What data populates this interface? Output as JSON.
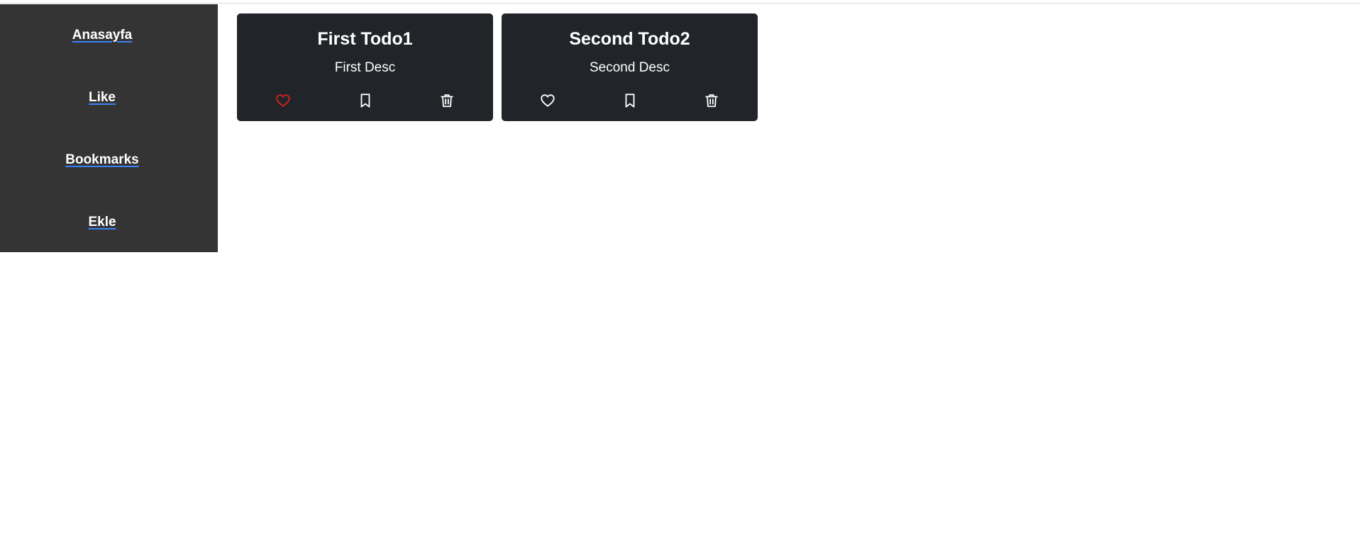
{
  "sidebar": {
    "items": [
      {
        "label": "Anasayfa"
      },
      {
        "label": "Like"
      },
      {
        "label": "Bookmarks"
      },
      {
        "label": "Ekle"
      }
    ]
  },
  "todos": [
    {
      "title": "First Todo1",
      "description": "First Desc",
      "liked": true,
      "bookmarked": false
    },
    {
      "title": "Second Todo2",
      "description": "Second Desc",
      "liked": false,
      "bookmarked": false
    }
  ],
  "icons": {
    "like": "heart-icon",
    "bookmark": "bookmark-icon",
    "delete": "trash-icon"
  },
  "colors": {
    "sidebar_bg": "#343434",
    "card_bg": "#212529",
    "liked": "#dc1e1e",
    "icon_default": "#ffffff",
    "link_underline": "#3b82f6"
  }
}
